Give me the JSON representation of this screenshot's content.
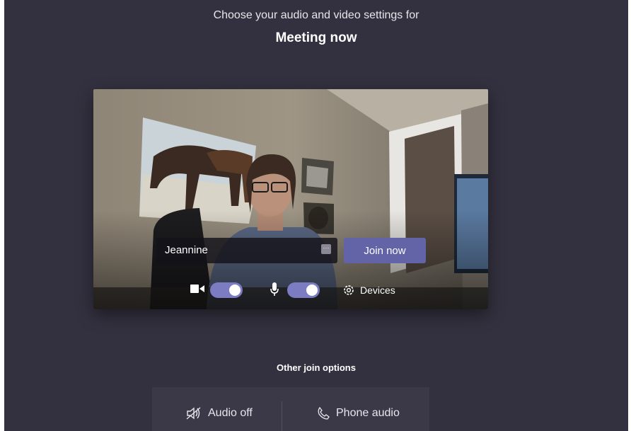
{
  "header": {
    "subtitle": "Choose your audio and video settings for",
    "meeting_title": "Meeting now"
  },
  "preview": {
    "name_value": "Jeannine",
    "join_label": "Join now",
    "video_toggle_on": true,
    "audio_toggle_on": true,
    "devices_label": "Devices"
  },
  "other_options": {
    "title": "Other join options",
    "audio_off_label": "Audio off",
    "phone_audio_label": "Phone audio"
  },
  "colors": {
    "background": "#33313f",
    "accent": "#6264a7",
    "toggle": "#7b7cc2"
  },
  "icons": [
    "camera-icon",
    "microphone-icon",
    "gear-icon",
    "speaker-off-icon",
    "phone-icon",
    "more-icon"
  ]
}
